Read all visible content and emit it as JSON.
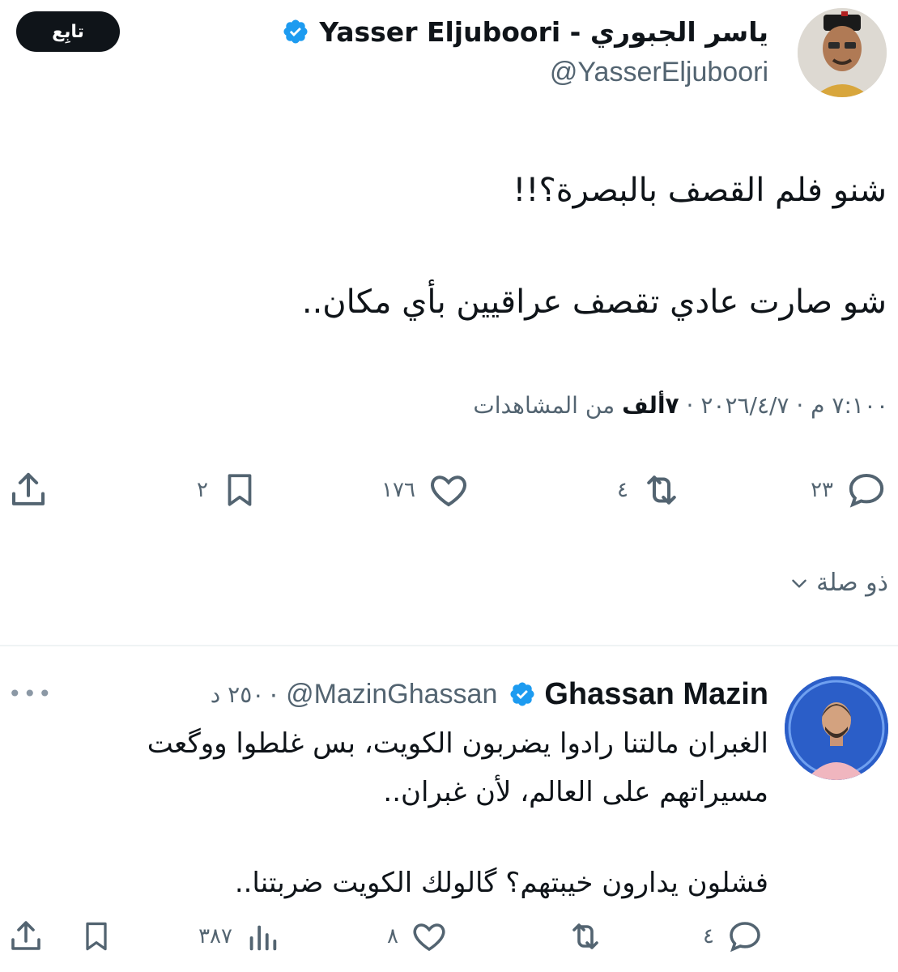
{
  "main_tweet": {
    "display_name": "ياسر الجبوري - Yasser Eljuboori",
    "handle": "@YasserEljuboori",
    "follow_label": "تابِع",
    "text_line1": "شنو فلم القصف بالبصرة؟!!",
    "text_line2": "شو صارت عادي تقصف عراقيين بأي مكان..",
    "timestamp": "٧:١٠٠ م · ٢٠٢٦/٤/٧",
    "views_count": "٧ألف",
    "views_label": "من المشاهدات",
    "actions": {
      "replies": "٢٣",
      "reposts": "٤",
      "likes": "١٧٦",
      "bookmarks": "٢"
    },
    "related_label": "ذو صلة"
  },
  "reply_tweet": {
    "display_name": "Ghassan Mazin",
    "handle": "@MazinGhassan",
    "time": "٢٥٠ د",
    "text_line1": "الغبران مالتنا رادوا يضربون الكويت، بس غلطوا ووگعت",
    "text_line2": "مسيراتهم على العالم، لأن غبران..",
    "text_line3": "فشلون يدارون خيبتهم؟ گالولك الكويت ضربتنا..",
    "actions": {
      "replies": "٤",
      "likes": "٨",
      "views": "٣٨٧"
    }
  },
  "colors": {
    "text_primary": "#0f1419",
    "text_secondary": "#536471",
    "verified_blue": "#1d9bf0",
    "divider": "#eff3f4"
  },
  "icons": [
    "verified-badge-icon",
    "reply-icon",
    "repost-icon",
    "like-icon",
    "bookmark-icon",
    "share-icon",
    "views-icon",
    "chevron-down-icon",
    "more-icon"
  ]
}
